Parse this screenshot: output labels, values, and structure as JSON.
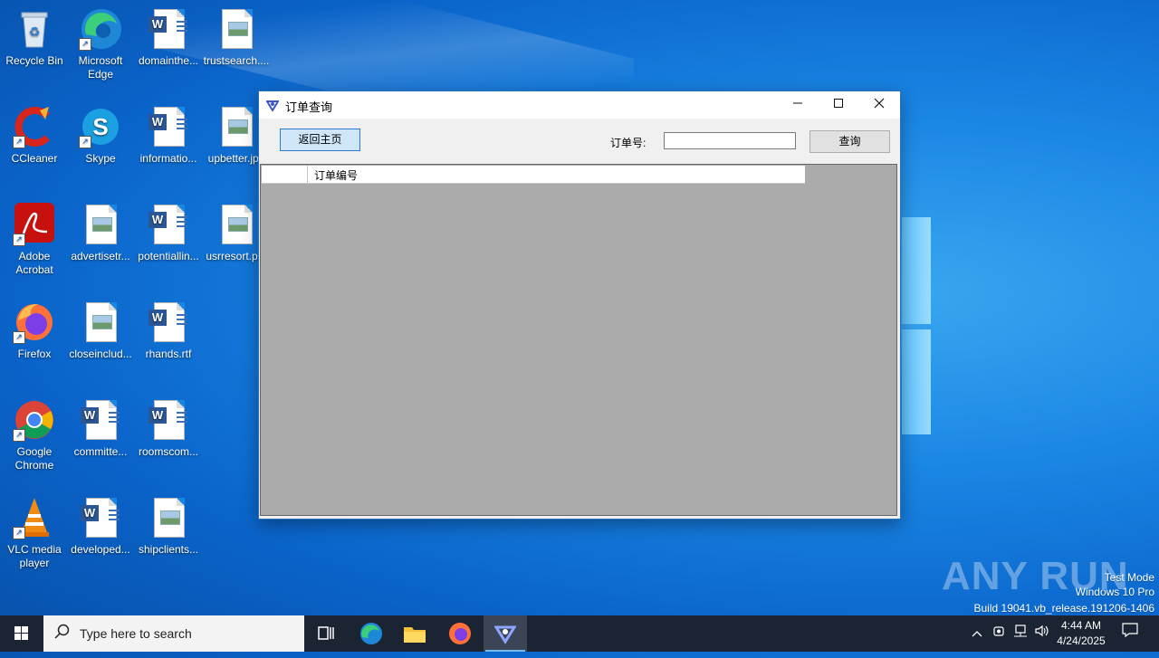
{
  "desktop": {
    "icons": [
      {
        "label": "Recycle Bin"
      },
      {
        "label": "Microsoft Edge"
      },
      {
        "label": "domainthe..."
      },
      {
        "label": "trustsearch...."
      },
      {
        "label": "CCleaner"
      },
      {
        "label": "Skype"
      },
      {
        "label": "informatio..."
      },
      {
        "label": "upbetter.jpg"
      },
      {
        "label": "Adobe Acrobat"
      },
      {
        "label": "advertisetr..."
      },
      {
        "label": "potentiallin..."
      },
      {
        "label": "usrresort.p..."
      },
      {
        "label": "Firefox"
      },
      {
        "label": "closeinclud..."
      },
      {
        "label": "rhands.rtf"
      },
      {
        "label": "Google Chrome"
      },
      {
        "label": "committe..."
      },
      {
        "label": "roomscom..."
      },
      {
        "label": "VLC media player"
      },
      {
        "label": "developed..."
      },
      {
        "label": "shipclients..."
      }
    ]
  },
  "window": {
    "title": "订单查询",
    "home_button": "返回主页",
    "order_label": "订单号:",
    "order_value": "",
    "query_button": "查询",
    "grid": {
      "columns": [
        "订单编号"
      ]
    }
  },
  "watermark": {
    "logo": "ANY RUN",
    "line1": "Test Mode",
    "line2": "Windows 10 Pro",
    "line3": "Build 19041.vb_release.191206-1406"
  },
  "taskbar": {
    "search_placeholder": "Type here to search",
    "time": "4:44 AM",
    "date": "4/24/2025"
  },
  "colors": {
    "accent": "#2f7ad1",
    "taskbar": "#1b2433",
    "grid_bg": "#ababab"
  }
}
